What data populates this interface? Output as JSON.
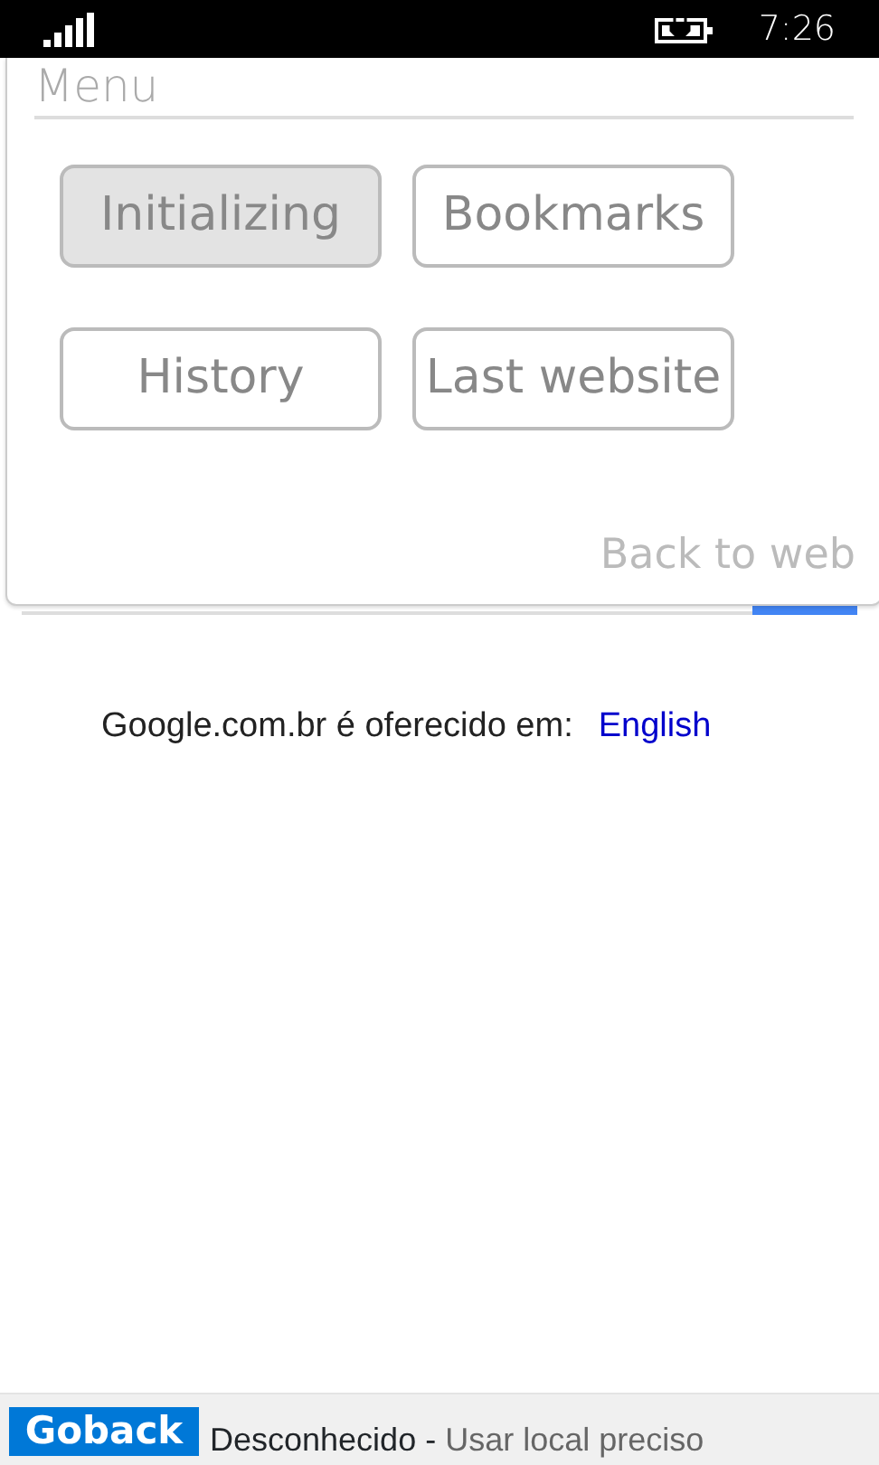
{
  "status_bar": {
    "time": "7:26"
  },
  "menu": {
    "title": "Menu",
    "items": [
      {
        "label": "Initializing",
        "selected": true
      },
      {
        "label": "Bookmarks",
        "selected": false
      },
      {
        "label": "History",
        "selected": false
      },
      {
        "label": "Last website",
        "selected": false
      }
    ],
    "back_link": "Back to web"
  },
  "web_page": {
    "language_text": "Google.com.br é oferecido em:",
    "language_link": "English",
    "footer": {
      "location": "Desconhecido",
      "separator": "-",
      "link": "Usar local preciso"
    }
  },
  "goback_button": "Goback"
}
